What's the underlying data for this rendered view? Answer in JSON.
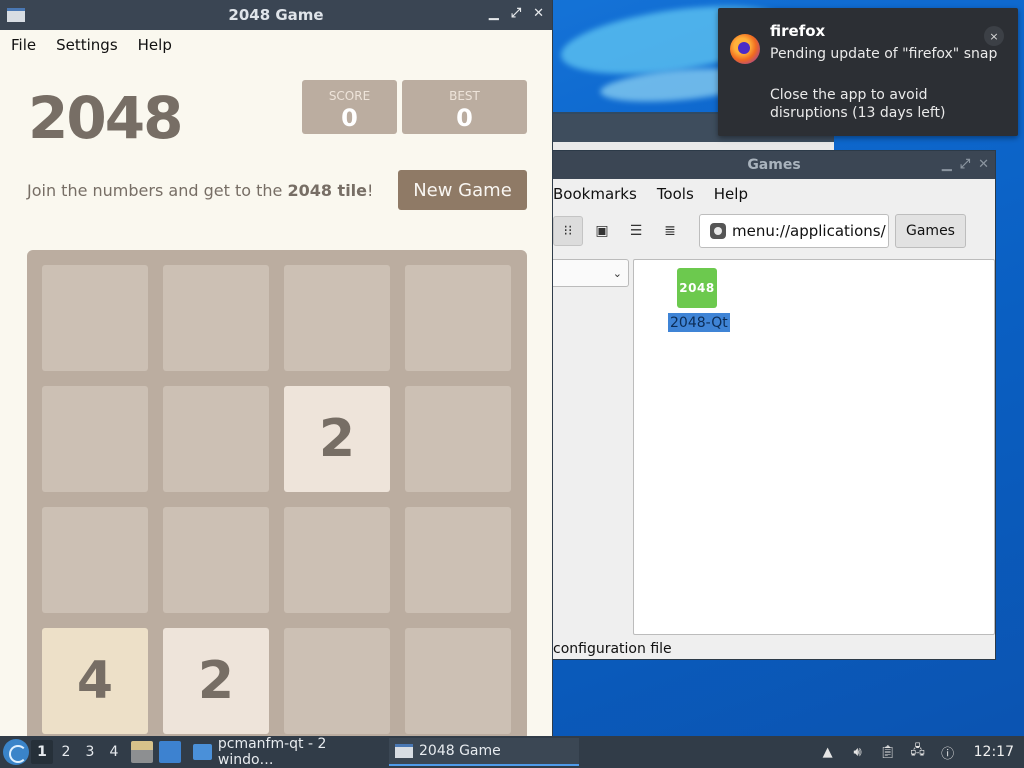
{
  "game_window": {
    "title": "2048 Game",
    "menu": [
      "File",
      "Settings",
      "Help"
    ],
    "logo": "2048",
    "score_label": "SCORE",
    "score_value": "0",
    "best_label": "BEST",
    "best_value": "0",
    "intro_before": "Join the numbers and get to the ",
    "intro_bold": "2048 tile",
    "intro_after": "!",
    "new_game_label": "New Game",
    "board": [
      [
        "",
        "",
        "",
        ""
      ],
      [
        "",
        "",
        "2",
        ""
      ],
      [
        "",
        "",
        "",
        ""
      ],
      [
        "4",
        "2",
        "",
        ""
      ]
    ],
    "tile_colors": {
      "2": "#eee4da",
      "4": "#ede0c8"
    }
  },
  "file_manager": {
    "title": "Games",
    "menu": [
      "Bookmarks",
      "Tools",
      "Help"
    ],
    "address": "menu://applications/",
    "breadcrumb": "Games",
    "item_icon_text": "2048",
    "item_label": "2048-Qt",
    "status": "configuration file"
  },
  "notification": {
    "app": "firefox",
    "line1": "Pending update of \"firefox\" snap",
    "line2": "Close the app to avoid disruptions (13 days left)",
    "close": "×"
  },
  "taskbar": {
    "workspaces": [
      "1",
      "2",
      "3",
      "4"
    ],
    "task1": "pcmanfm-qt - 2 windo…",
    "task2": "2048 Game",
    "clock": "12:17"
  }
}
